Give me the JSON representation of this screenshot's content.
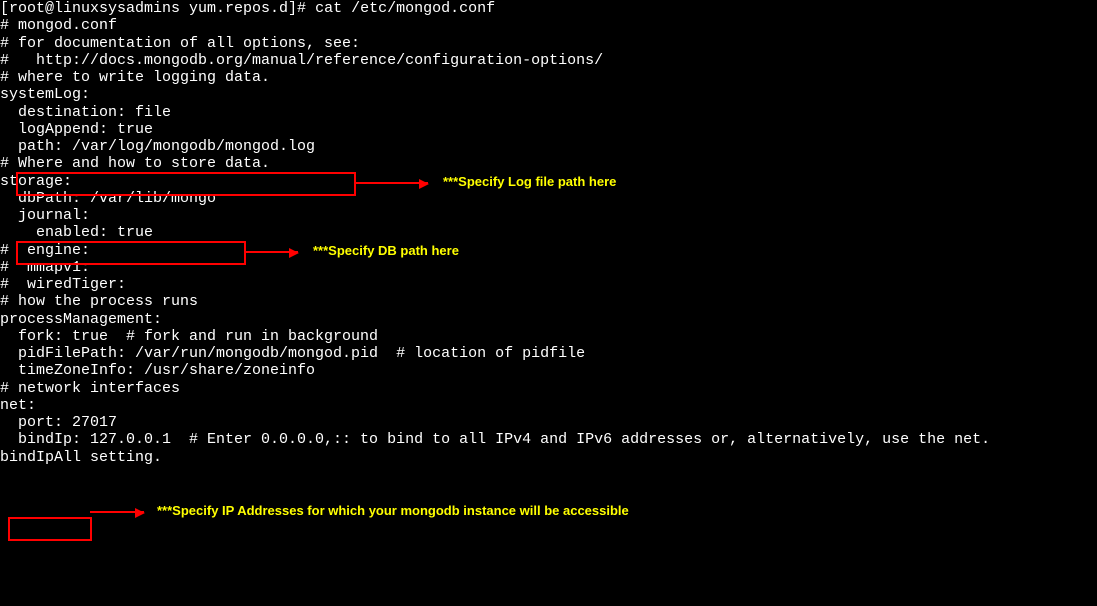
{
  "prompt": "[root@linuxsysadmins yum.repos.d]# ",
  "command": "cat /etc/mongod.conf",
  "lines": {
    "l1": "# mongod.conf",
    "l2": "",
    "l3": "# for documentation of all options, see:",
    "l4": "#   http://docs.mongodb.org/manual/reference/configuration-options/",
    "l5": "",
    "l6": "# where to write logging data.",
    "l7": "systemLog:",
    "l8": "  destination: file",
    "l9": "  logAppend: true",
    "l10": "  path: /var/log/mongodb/mongod.log",
    "l11": "",
    "l12": "# Where and how to store data.",
    "l13": "storage:",
    "l14": "  dbPath: /var/lib/mongo",
    "l15": "  journal:",
    "l16": "    enabled: true",
    "l17": "#  engine:",
    "l18": "#  mmapv1:",
    "l19": "#  wiredTiger:",
    "l20": "",
    "l21": "# how the process runs",
    "l22": "processManagement:",
    "l23": "  fork: true  # fork and run in background",
    "l24": "  pidFilePath: /var/run/mongodb/mongod.pid  # location of pidfile",
    "l25": "  timeZoneInfo: /usr/share/zoneinfo",
    "l26": "",
    "l27": "# network interfaces",
    "l28": "net:",
    "l29": "  port: 27017",
    "l30": "  bindIp: 127.0.0.1  # Enter 0.0.0.0,:: to bind to all IPv4 and IPv6 addresses or, alternatively, use the net.",
    "l31": "bindIpAll setting."
  },
  "annotations": {
    "log_path": "***Specify Log file path here",
    "db_path": "***Specify DB path here",
    "bind_ip": "***Specify IP Addresses for which your mongodb instance will be accessible"
  }
}
